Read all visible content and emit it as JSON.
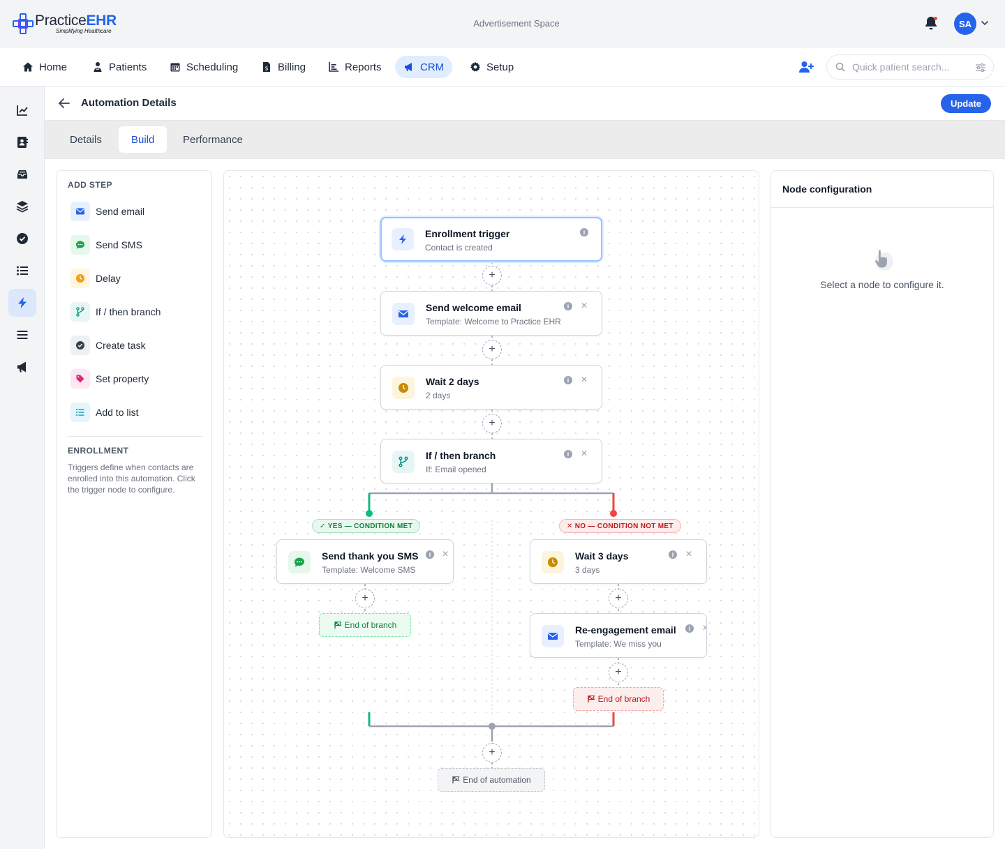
{
  "header": {
    "logo_text_prefix": "Practice",
    "logo_text_accent": "EHR",
    "logo_tagline": "Simplifying Healthcare",
    "ad_space": "Advertisement Space",
    "avatar_initials": "SA"
  },
  "nav": {
    "items": [
      {
        "label": "Home",
        "icon": "home-icon"
      },
      {
        "label": "Patients",
        "icon": "patients-icon"
      },
      {
        "label": "Scheduling",
        "icon": "calendar-icon"
      },
      {
        "label": "Billing",
        "icon": "billing-icon"
      },
      {
        "label": "Reports",
        "icon": "reports-icon"
      },
      {
        "label": "CRM",
        "icon": "megaphone-icon",
        "active": true
      },
      {
        "label": "Setup",
        "icon": "gear-icon"
      }
    ],
    "search_placeholder": "Quick patient search..."
  },
  "rail": {
    "items": [
      "chart-line-icon",
      "contacts-icon",
      "inbox-icon",
      "layers-icon",
      "check-circle-icon",
      "list-icon",
      "bolt-icon",
      "menu-icon",
      "megaphone-icon"
    ],
    "active": "bolt-icon"
  },
  "page": {
    "title": "Automation Details",
    "update_label": "Update",
    "tabs": [
      "Details",
      "Build",
      "Performance"
    ],
    "active_tab": "Build"
  },
  "add_step": {
    "heading": "ADD STEP",
    "items": [
      {
        "label": "Send email",
        "icon": "mail-icon",
        "color": "#2563eb",
        "bg": "#e8efff"
      },
      {
        "label": "Send SMS",
        "icon": "chat-icon",
        "color": "#16a34a",
        "bg": "#e6f7ec"
      },
      {
        "label": "Delay",
        "icon": "clock-icon",
        "color": "#f59e0b",
        "bg": "#fff5e0"
      },
      {
        "label": "If / then branch",
        "icon": "branch-icon",
        "color": "#0d9488",
        "bg": "#e6f6f4"
      },
      {
        "label": "Create task",
        "icon": "check-circle-icon",
        "color": "#374151",
        "bg": "#eef0f3"
      },
      {
        "label": "Set property",
        "icon": "tag-icon",
        "color": "#db2777",
        "bg": "#fde8f1"
      },
      {
        "label": "Add to list",
        "icon": "list-icon",
        "color": "#0891b2",
        "bg": "#e3f6fb"
      }
    ],
    "enrollment_heading": "ENROLLMENT",
    "enrollment_text": "Triggers define when contacts are enrolled into this automation. Click the trigger node to configure."
  },
  "flow": {
    "trigger": {
      "title": "Enrollment trigger",
      "subtitle": "Contact is created"
    },
    "step1": {
      "title": "Send welcome email",
      "subtitle": "Template: Welcome to Practice EHR"
    },
    "step2": {
      "title": "Wait 2 days",
      "subtitle": "2 days"
    },
    "step3": {
      "title": "If / then branch",
      "subtitle": "If: Email opened"
    },
    "yes_label": "YES — CONDITION MET",
    "no_label": "NO — CONDITION NOT MET",
    "yes_step": {
      "title": "Send thank you SMS",
      "subtitle": "Template: Welcome SMS"
    },
    "yes_end": "End of branch",
    "no_step1": {
      "title": "Wait 3 days",
      "subtitle": "3 days"
    },
    "no_step2": {
      "title": "Re-engagement email",
      "subtitle": "Template: We miss you"
    },
    "no_end": "End of branch",
    "end": "End of automation",
    "colors": {
      "yes": "#10b981",
      "no": "#ef4444",
      "connector": "#9ca3af"
    }
  },
  "config": {
    "title": "Node configuration",
    "empty_text": "Select a node to configure it."
  }
}
